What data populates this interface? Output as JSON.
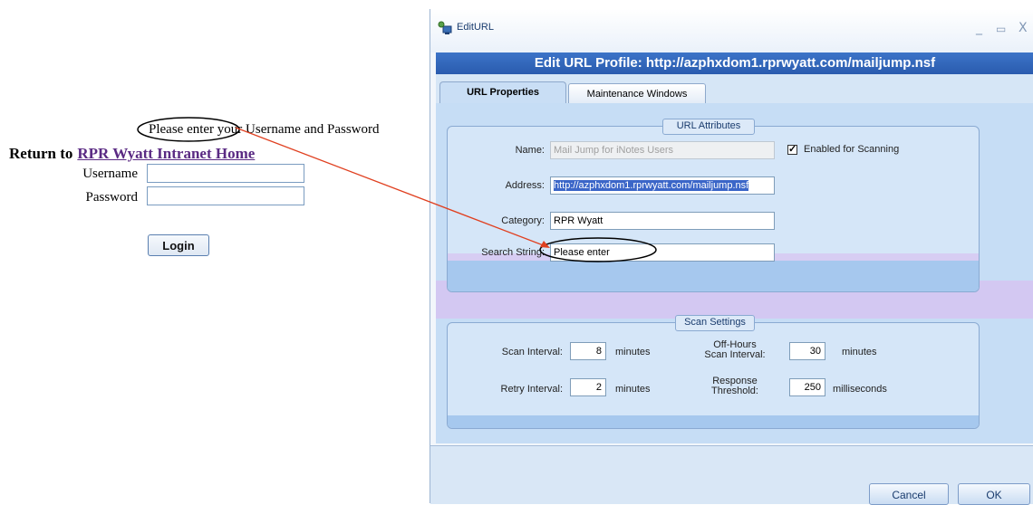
{
  "web": {
    "prompt": "Please enter your Username and Password",
    "return_prefix": "Return to",
    "return_link": "RPR Wyatt Intranet Home",
    "username_label": "Username",
    "password_label": "Password",
    "username_value": "",
    "password_value": "",
    "login_label": "Login"
  },
  "dialog": {
    "window_title": "EditURL",
    "controls": {
      "minimize": "_",
      "maximize": "▭",
      "close": "X"
    },
    "header": "Edit URL Profile: http://azphxdom1.rprwyatt.com/mailjump.nsf",
    "tabs": [
      {
        "label": "URL Properties",
        "active": true
      },
      {
        "label": "Maintenance Windows",
        "active": false
      }
    ],
    "url_attributes": {
      "legend": "URL Attributes",
      "name_label": "Name:",
      "name_value": "Mail Jump for iNotes Users",
      "enabled_label": "Enabled for Scanning",
      "enabled_checked": true,
      "address_label": "Address:",
      "address_value": "http://azphxdom1.rprwyatt.com/mailjump.nsf",
      "category_label": "Category:",
      "category_value": "RPR Wyatt",
      "search_label": "Search String:",
      "search_value": "Please enter"
    },
    "scan_settings": {
      "legend": "Scan Settings",
      "scan_interval_label": "Scan Interval:",
      "scan_interval_value": "8",
      "scan_interval_unit": "minutes",
      "offhours_label_1": "Off-Hours",
      "offhours_label_2": "Scan Interval:",
      "offhours_value": "30",
      "offhours_unit": "minutes",
      "retry_interval_label": "Retry Interval:",
      "retry_interval_value": "2",
      "retry_interval_unit": "minutes",
      "response_label_1": "Response",
      "response_label_2": "Threshold:",
      "response_value": "250",
      "response_unit": "milliseconds"
    },
    "buttons": {
      "cancel": "Cancel",
      "ok": "OK"
    }
  },
  "colors": {
    "header_blue": "#2a5bae",
    "annotation_arrow": "#e04020",
    "link_purple": "#5a2a83"
  }
}
